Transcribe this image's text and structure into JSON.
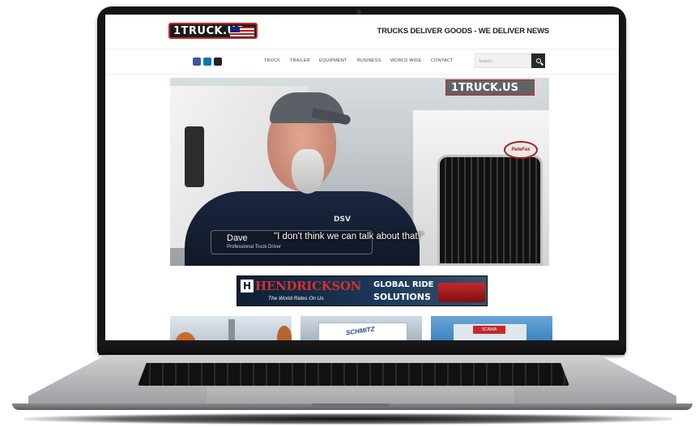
{
  "site": {
    "logo_text": "1TRUCK.US",
    "tagline": "TRUCKS DELIVER GOODS - WE DELIVER NEWS"
  },
  "nav": {
    "items": [
      "TRUCK",
      "TRAILER",
      "EQUIPMENT",
      "BUSINESS",
      "WORLD WIDE",
      "CONTACT"
    ],
    "search_placeholder": "Search..."
  },
  "social": [
    {
      "icon": "facebook-icon",
      "color": "#3b5998"
    },
    {
      "icon": "linkedin-icon",
      "color": "#0077b5"
    },
    {
      "icon": "video-icon",
      "color": "#222222"
    }
  ],
  "hero": {
    "watermark": "1TRUCK.US",
    "quote": "\"I don't think we can talk about that!\"",
    "name": "Dave",
    "role": "Professional Truck Driver",
    "shirt_logo": "DSV",
    "grille_badge": "PeteFex"
  },
  "ad": {
    "logo_letter": "H",
    "brand": "HENDRICKSON",
    "slogan": "The World Rides On Us",
    "headline_line1": "GLOBAL RIDE",
    "headline_line2": "SOLUTIONS"
  },
  "thumbs": {
    "thumb2_brand": "SCHMITZ",
    "thumb3_sign": "SCANIA"
  },
  "colors": {
    "accent": "#c62828",
    "header_text": "#222222",
    "bezel": "#151515"
  }
}
